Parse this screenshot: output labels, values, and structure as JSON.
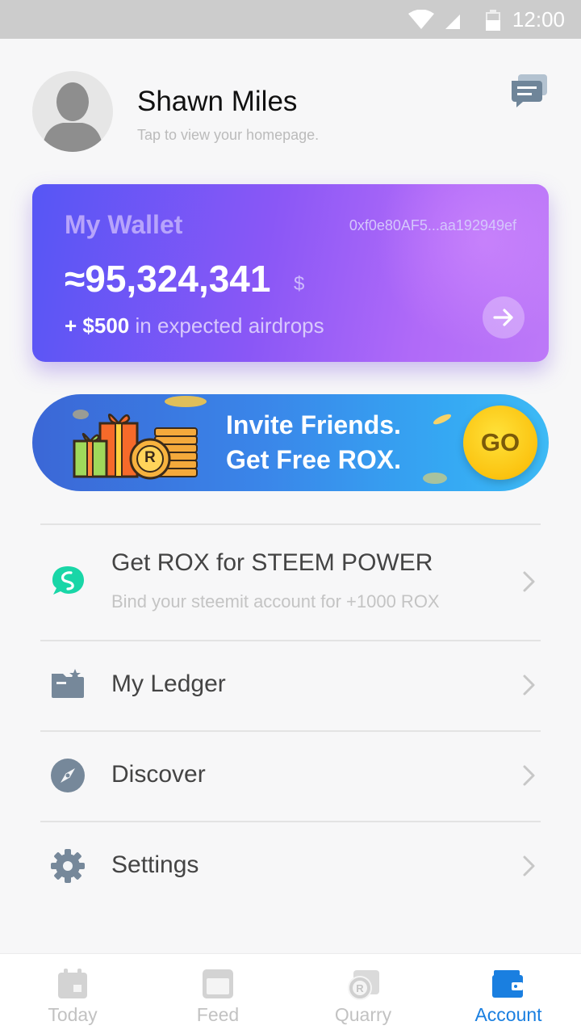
{
  "status_bar": {
    "time": "12:00",
    "icons": [
      "wifi-icon",
      "cell-signal-icon",
      "battery-icon"
    ]
  },
  "profile": {
    "name": "Shawn Miles",
    "note": "Tap to view your homepage.",
    "message_icon": "chat-bubbles-icon"
  },
  "wallet": {
    "title": "My Wallet",
    "address": "0xf0e80AF5...aa192949ef",
    "balance": "≈95,324,341",
    "currency": "$",
    "airdrop_amount": "+ $500",
    "airdrop_text": "in expected airdrops",
    "arrow_icon": "arrow-right-icon"
  },
  "invite_banner": {
    "line1": "Invite Friends.",
    "line2": "Get Free ROX.",
    "go_label": "GO",
    "coin_letter": "R"
  },
  "menu": {
    "items": [
      {
        "label": "Get ROX for STEEM POWER",
        "sub": "Bind your steemit account for +1000 ROX",
        "icon": "steemit-icon"
      },
      {
        "label": "My Ledger",
        "sub": "",
        "icon": "ledger-wallet-icon"
      },
      {
        "label": "Discover",
        "sub": "",
        "icon": "compass-icon"
      },
      {
        "label": "Settings",
        "sub": "",
        "icon": "gear-icon"
      }
    ]
  },
  "bottom_nav": {
    "items": [
      {
        "label": "Today",
        "icon": "calendar-icon",
        "active": false
      },
      {
        "label": "Feed",
        "icon": "feed-window-icon",
        "active": false
      },
      {
        "label": "Quarry",
        "icon": "quarry-coin-icon",
        "active": false
      },
      {
        "label": "Account",
        "icon": "wallet-icon",
        "active": true
      }
    ]
  },
  "colors": {
    "accent": "#1a7fe0",
    "wallet_gradient_start": "#5656f5",
    "wallet_gradient_end": "#bd79f8",
    "invite_gradient_start": "#3b67d6",
    "invite_gradient_end": "#3dbaf5",
    "go_button": "#fbc310",
    "steemit_green": "#19d6a7"
  }
}
